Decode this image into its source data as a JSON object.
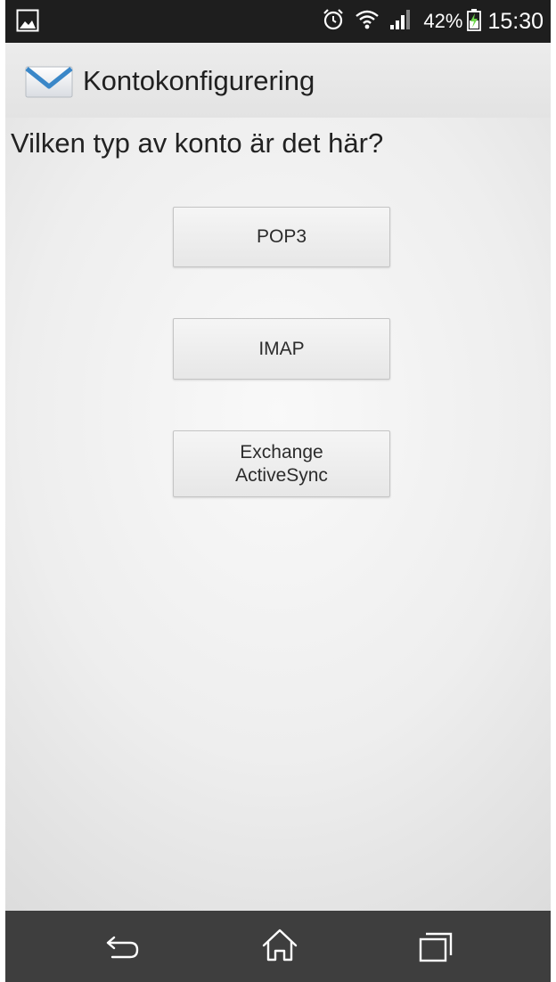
{
  "status_bar": {
    "left_icon": "image-notification-icon",
    "icons": [
      "alarm-icon",
      "wifi-icon",
      "signal-icon"
    ],
    "battery_percent": "42%",
    "battery_icon": "battery-charging-icon",
    "time": "15:30"
  },
  "action_bar": {
    "icon": "envelope-icon",
    "title": "Kontokonfigurering"
  },
  "main": {
    "question": "Vilken typ av konto är det här?",
    "buttons": [
      {
        "label": "POP3"
      },
      {
        "label": "IMAP"
      },
      {
        "label_line1": "Exchange",
        "label_line2": "ActiveSync"
      }
    ]
  },
  "nav_bar": {
    "icons": [
      "back-icon",
      "home-icon",
      "recent-apps-icon"
    ]
  },
  "colors": {
    "status_bar_bg": "#1e1e1e",
    "nav_bar_bg": "#3e3e3e",
    "envelope_blue": "#3a87c8"
  }
}
